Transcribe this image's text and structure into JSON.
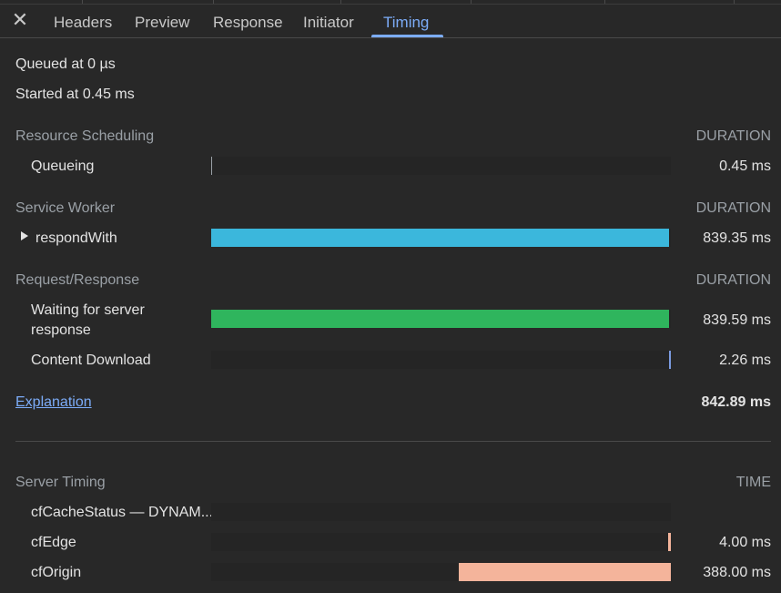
{
  "tabs": {
    "close_glyph": "✕",
    "items": [
      "Headers",
      "Preview",
      "Response",
      "Initiator",
      "Timing"
    ],
    "active": "Timing",
    "accent_color": "#7cacf8"
  },
  "summary": {
    "queued": "Queued at 0 µs",
    "started": "Started at 0.45 ms"
  },
  "resource_scheduling": {
    "title": "Resource Scheduling",
    "duration_label": "DURATION",
    "rows": [
      {
        "label": "Queueing",
        "value": "0.45 ms",
        "bar_start": 0.0,
        "bar_fraction": 0.0
      }
    ]
  },
  "service_worker": {
    "title": "Service Worker",
    "duration_label": "DURATION",
    "rows": [
      {
        "label": "respondWith",
        "value": "839.35 ms",
        "color": "#3bb7dc",
        "bar_start": 0.0,
        "bar_fraction": 0.996
      }
    ]
  },
  "request_response": {
    "title": "Request/Response",
    "duration_label": "DURATION",
    "rows": [
      {
        "label_line1": "Waiting for server",
        "label_line2": "response",
        "value": "839.59 ms",
        "color": "#2fb55d",
        "bar_start": 0.0,
        "bar_fraction": 0.996
      },
      {
        "label": "Content Download",
        "value": "2.26 ms",
        "color": "#7b9be0",
        "bar_start": 0.996,
        "bar_fraction": 0.003
      }
    ]
  },
  "explanation": {
    "link": "Explanation",
    "total": "842.89 ms"
  },
  "server_timing": {
    "title": "Server Timing",
    "time_label": "TIME",
    "rows": [
      {
        "label": "cfCacheStatus — DYNAM...",
        "value": ""
      },
      {
        "label": "cfEdge",
        "value": "4.00 ms",
        "color": "#f4b49b",
        "bar_start": 0.994,
        "bar_fraction": 0.006
      },
      {
        "label": "cfOrigin",
        "value": "388.00 ms",
        "color": "#f4b49b",
        "bar_start": 0.54,
        "bar_fraction": 0.46
      }
    ]
  }
}
